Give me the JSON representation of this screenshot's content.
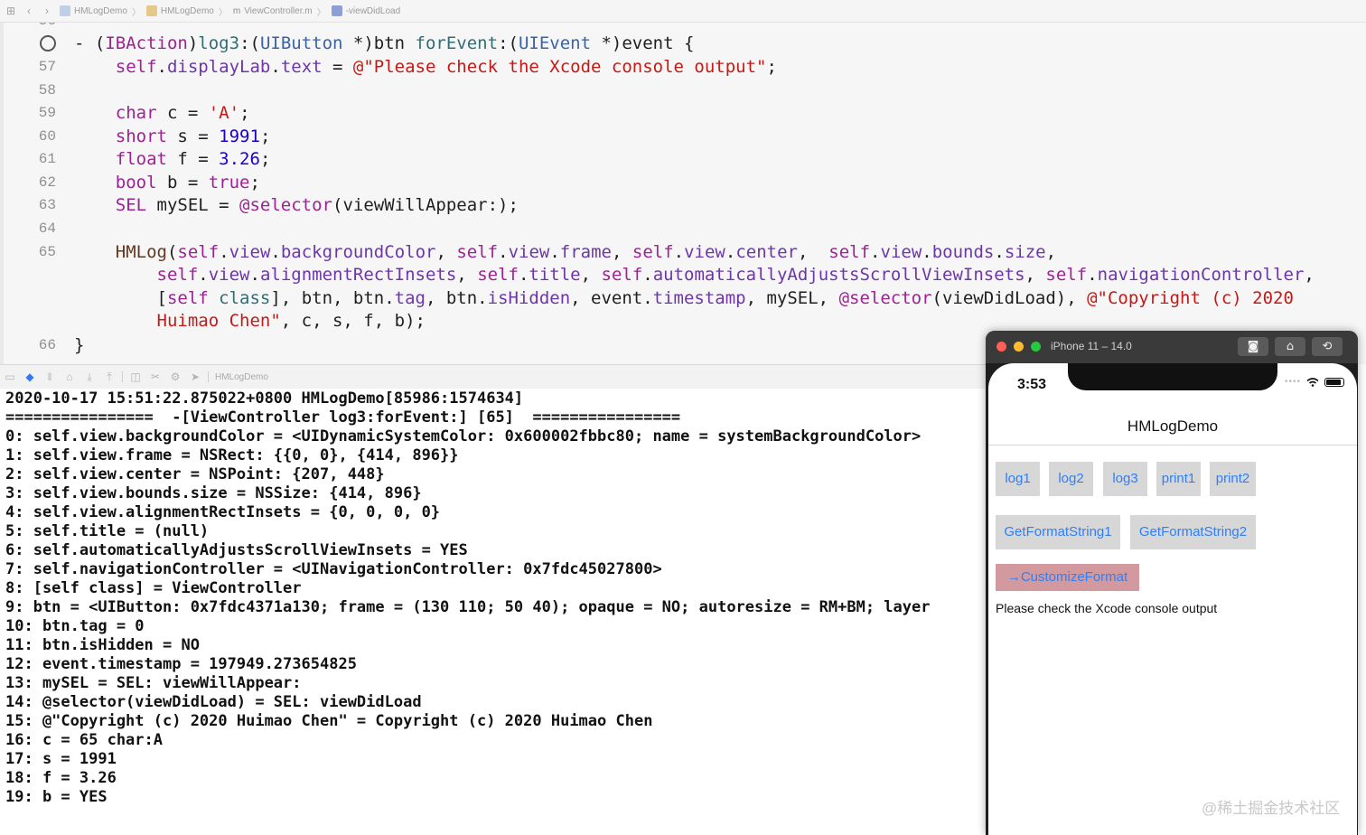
{
  "breadcrumb": [
    "HMLogDemo",
    "HMLogDemo",
    "ViewController.m",
    "-viewDidLoad"
  ],
  "debug_bar": {
    "process": "HMLogDemo"
  },
  "console_lines": [
    "2020-10-17 15:51:22.875022+0800 HMLogDemo[85986:1574634]",
    "================  -[ViewController log3:forEvent:] [65]  ================",
    "0: self.view.backgroundColor = <UIDynamicSystemColor: 0x600002fbbc80; name = systemBackgroundColor>",
    "1: self.view.frame = NSRect: {{0, 0}, {414, 896}}",
    "2: self.view.center = NSPoint: {207, 448}",
    "3: self.view.bounds.size = NSSize: {414, 896}",
    "4: self.view.alignmentRectInsets = {0, 0, 0, 0}",
    "5: self.title = (null)",
    "6: self.automaticallyAdjustsScrollViewInsets = YES",
    "7: self.navigationController = <UINavigationController: 0x7fdc45027800>",
    "8: [self class] = ViewController",
    "9: btn = <UIButton: 0x7fdc4371a130; frame = (130 110; 50 40); opaque = NO; autoresize = RM+BM; layer",
    "10: btn.tag = 0",
    "11: btn.isHidden = NO",
    "12: event.timestamp = 197949.273654825",
    "13: mySEL = SEL: viewWillAppear:",
    "14: @selector(viewDidLoad) = SEL: viewDidLoad",
    "15: @\"Copyright (c) 2020 Huimao Chen\" = Copyright (c) 2020 Huimao Chen",
    "16: c = 65 char:A",
    "17: s = 1991",
    "18: f = 3.26",
    "19: b = YES"
  ],
  "simulator": {
    "device": "iPhone 11 – 14.0",
    "time": "3:53",
    "nav_title": "HMLogDemo",
    "buttons": [
      "log1",
      "log2",
      "log3",
      "print1",
      "print2",
      "GetFormatString1",
      "GetFormatString2",
      "→CustomizeFormat"
    ],
    "output_label": "Please check the Xcode console output"
  },
  "watermark": "@稀土掘金技术社区"
}
